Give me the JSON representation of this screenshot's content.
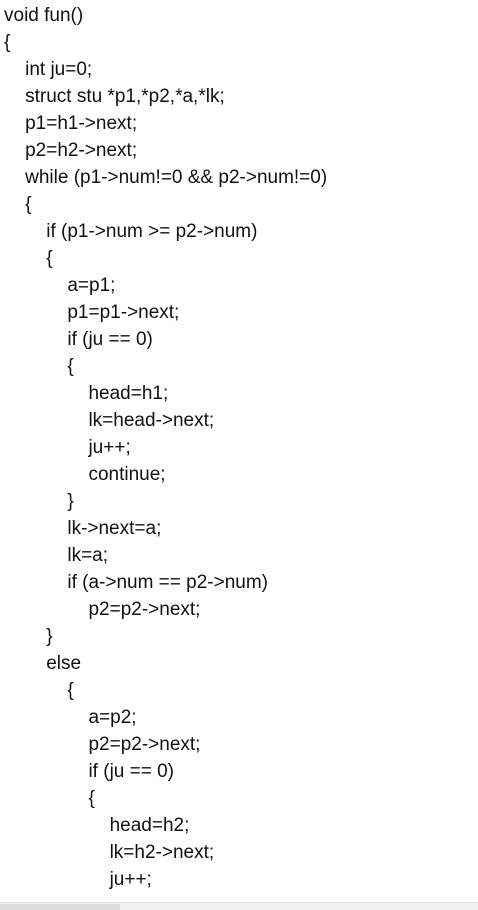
{
  "code": {
    "lines": [
      "void fun()",
      "{",
      "    int ju=0;",
      "    struct stu *p1,*p2,*a,*lk;",
      "    p1=h1->next;",
      "    p2=h2->next;",
      "    while (p1->num!=0 && p2->num!=0)",
      "    {",
      "        if (p1->num >= p2->num)",
      "        {",
      "            a=p1;",
      "            p1=p1->next;",
      "            if (ju == 0)",
      "            {",
      "                head=h1;",
      "                lk=head->next;",
      "                ju++;",
      "                continue;",
      "            }",
      "            lk->next=a;",
      "            lk=a;",
      "            if (a->num == p2->num)",
      "                p2=p2->next;",
      "        }",
      "        else",
      "            {",
      "                a=p2;",
      "                p2=p2->next;",
      "                if (ju == 0)",
      "                {",
      "                    head=h2;",
      "                    lk=h2->next;",
      "                    ju++;"
    ]
  }
}
